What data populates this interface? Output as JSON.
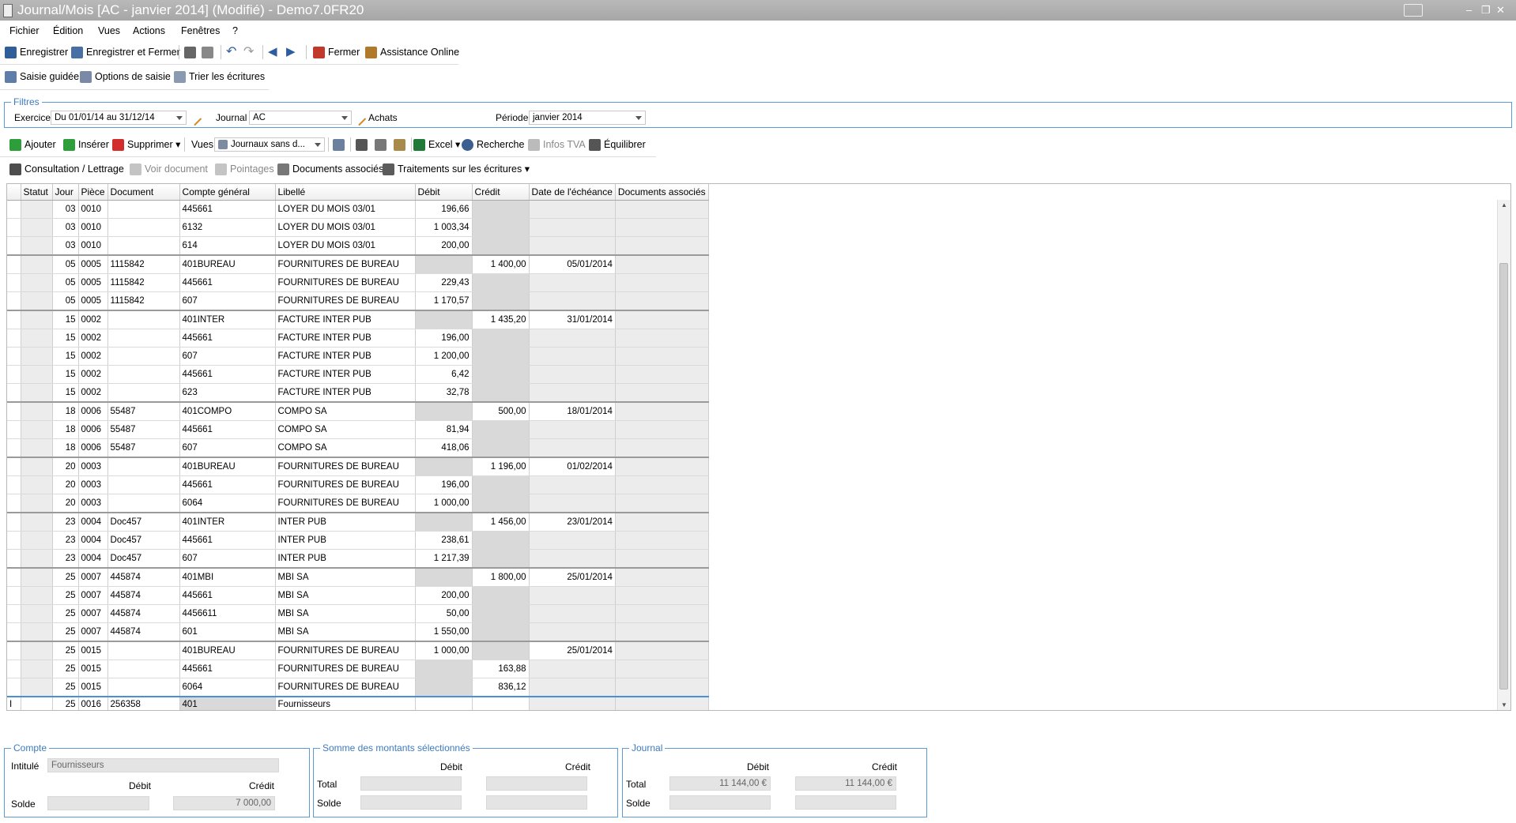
{
  "window": {
    "title": "Journal/Mois [AC - janvier 2014] (Modifié) - Demo7.0FR20",
    "min": "–",
    "max": "❐",
    "close": "✕"
  },
  "menu": [
    "Fichier",
    "Édition",
    "Vues",
    "Actions",
    "Fenêtres",
    "?"
  ],
  "toolbar1": {
    "save": "Enregistrer",
    "save_close": "Enregistrer et Fermer",
    "close": "Fermer",
    "online_help": "Assistance Online"
  },
  "toolbar2": {
    "guided_entry": "Saisie guidée",
    "entry_options": "Options de saisie",
    "sort_entries": "Trier les écritures"
  },
  "filters": {
    "title": "Filtres",
    "exercise_label": "Exercice",
    "exercise_value": "Du 01/01/14 au 31/12/14",
    "journal_label": "Journal",
    "journal_value": "AC",
    "journal_name": "Achats",
    "period_label": "Période",
    "period_value": "janvier 2014"
  },
  "toolbar3": {
    "add": "Ajouter",
    "insert": "Insérer",
    "delete": "Supprimer",
    "views_label": "Vues",
    "views_value": "Journaux sans d...",
    "excel": "Excel",
    "search": "Recherche",
    "vat_info": "Infos TVA",
    "balance": "Équilibrer"
  },
  "toolbar4": {
    "consultation": "Consultation / Lettrage",
    "view_doc": "Voir document",
    "pointings": "Pointages",
    "linked_docs": "Documents associés",
    "processing": "Traitements sur les écritures"
  },
  "grid": {
    "columns": [
      "Statut",
      "Jour",
      "Pièce",
      "Document",
      "Compte général",
      "Libellé",
      "Débit",
      "Crédit",
      "Date de l'échéance",
      "Documents associés"
    ],
    "rows": [
      {
        "jour": "03",
        "piece": "0010",
        "doc": "",
        "compte": "445661",
        "libelle": "LOYER DU MOIS 03/01",
        "debit": "196,66",
        "credit": "",
        "echeance": "",
        "g": true
      },
      {
        "jour": "03",
        "piece": "0010",
        "doc": "",
        "compte": "6132",
        "libelle": "LOYER DU MOIS 03/01",
        "debit": "1 003,34",
        "credit": "",
        "echeance": "",
        "g": false
      },
      {
        "jour": "03",
        "piece": "0010",
        "doc": "",
        "compte": "614",
        "libelle": "LOYER DU MOIS 03/01",
        "debit": "200,00",
        "credit": "",
        "echeance": "",
        "g": false
      },
      {
        "jour": "05",
        "piece": "0005",
        "doc": "1115842",
        "compte": "401BUREAU",
        "libelle": "FOURNITURES DE BUREAU",
        "debit": "",
        "credit": "1 400,00",
        "echeance": "05/01/2014",
        "g": true
      },
      {
        "jour": "05",
        "piece": "0005",
        "doc": "1115842",
        "compte": "445661",
        "libelle": "FOURNITURES DE BUREAU",
        "debit": "229,43",
        "credit": "",
        "echeance": "",
        "g": false
      },
      {
        "jour": "05",
        "piece": "0005",
        "doc": "1115842",
        "compte": "607",
        "libelle": "FOURNITURES DE BUREAU",
        "debit": "1 170,57",
        "credit": "",
        "echeance": "",
        "g": false
      },
      {
        "jour": "15",
        "piece": "0002",
        "doc": "",
        "compte": "401INTER",
        "libelle": "FACTURE INTER PUB",
        "debit": "",
        "credit": "1 435,20",
        "echeance": "31/01/2014",
        "g": true
      },
      {
        "jour": "15",
        "piece": "0002",
        "doc": "",
        "compte": "445661",
        "libelle": "FACTURE INTER PUB",
        "debit": "196,00",
        "credit": "",
        "echeance": "",
        "g": false
      },
      {
        "jour": "15",
        "piece": "0002",
        "doc": "",
        "compte": "607",
        "libelle": "FACTURE INTER PUB",
        "debit": "1 200,00",
        "credit": "",
        "echeance": "",
        "g": false
      },
      {
        "jour": "15",
        "piece": "0002",
        "doc": "",
        "compte": "445661",
        "libelle": "FACTURE INTER PUB",
        "debit": "6,42",
        "credit": "",
        "echeance": "",
        "g": false
      },
      {
        "jour": "15",
        "piece": "0002",
        "doc": "",
        "compte": "623",
        "libelle": "FACTURE INTER PUB",
        "debit": "32,78",
        "credit": "",
        "echeance": "",
        "g": false
      },
      {
        "jour": "18",
        "piece": "0006",
        "doc": "55487",
        "compte": "401COMPO",
        "libelle": "COMPO SA",
        "debit": "",
        "credit": "500,00",
        "echeance": "18/01/2014",
        "g": true
      },
      {
        "jour": "18",
        "piece": "0006",
        "doc": "55487",
        "compte": "445661",
        "libelle": "COMPO SA",
        "debit": "81,94",
        "credit": "",
        "echeance": "",
        "g": false
      },
      {
        "jour": "18",
        "piece": "0006",
        "doc": "55487",
        "compte": "607",
        "libelle": "COMPO SA",
        "debit": "418,06",
        "credit": "",
        "echeance": "",
        "g": false
      },
      {
        "jour": "20",
        "piece": "0003",
        "doc": "",
        "compte": "401BUREAU",
        "libelle": "FOURNITURES DE BUREAU",
        "debit": "",
        "credit": "1 196,00",
        "echeance": "01/02/2014",
        "g": true
      },
      {
        "jour": "20",
        "piece": "0003",
        "doc": "",
        "compte": "445661",
        "libelle": "FOURNITURES DE BUREAU",
        "debit": "196,00",
        "credit": "",
        "echeance": "",
        "g": false
      },
      {
        "jour": "20",
        "piece": "0003",
        "doc": "",
        "compte": "6064",
        "libelle": "FOURNITURES DE BUREAU",
        "debit": "1 000,00",
        "credit": "",
        "echeance": "",
        "g": false
      },
      {
        "jour": "23",
        "piece": "0004",
        "doc": "Doc457",
        "compte": "401INTER",
        "libelle": "INTER PUB",
        "debit": "",
        "credit": "1 456,00",
        "echeance": "23/01/2014",
        "g": true
      },
      {
        "jour": "23",
        "piece": "0004",
        "doc": "Doc457",
        "compte": "445661",
        "libelle": "INTER PUB",
        "debit": "238,61",
        "credit": "",
        "echeance": "",
        "g": false
      },
      {
        "jour": "23",
        "piece": "0004",
        "doc": "Doc457",
        "compte": "607",
        "libelle": "INTER PUB",
        "debit": "1 217,39",
        "credit": "",
        "echeance": "",
        "g": false
      },
      {
        "jour": "25",
        "piece": "0007",
        "doc": "445874",
        "compte": "401MBI",
        "libelle": "MBI SA",
        "debit": "",
        "credit": "1 800,00",
        "echeance": "25/01/2014",
        "g": true
      },
      {
        "jour": "25",
        "piece": "0007",
        "doc": "445874",
        "compte": "445661",
        "libelle": "MBI SA",
        "debit": "200,00",
        "credit": "",
        "echeance": "",
        "g": false
      },
      {
        "jour": "25",
        "piece": "0007",
        "doc": "445874",
        "compte": "4456611",
        "libelle": "MBI SA",
        "debit": "50,00",
        "credit": "",
        "echeance": "",
        "g": false
      },
      {
        "jour": "25",
        "piece": "0007",
        "doc": "445874",
        "compte": "601",
        "libelle": "MBI SA",
        "debit": "1 550,00",
        "credit": "",
        "echeance": "",
        "g": false
      },
      {
        "jour": "25",
        "piece": "0015",
        "doc": "",
        "compte": "401BUREAU",
        "libelle": "FOURNITURES DE BUREAU",
        "debit": "1 000,00",
        "credit": "",
        "echeance": "25/01/2014",
        "g": true
      },
      {
        "jour": "25",
        "piece": "0015",
        "doc": "",
        "compte": "445661",
        "libelle": "FOURNITURES DE BUREAU",
        "debit": "",
        "credit": "163,88",
        "echeance": "",
        "g": false
      },
      {
        "jour": "25",
        "piece": "0015",
        "doc": "",
        "compte": "6064",
        "libelle": "FOURNITURES DE BUREAU",
        "debit": "",
        "credit": "836,12",
        "echeance": "",
        "g": false
      }
    ],
    "edit_row": {
      "jour": "25",
      "piece": "0016",
      "doc": "256358",
      "compte": "401",
      "libelle": "Fournisseurs"
    }
  },
  "account_panel": {
    "title": "Compte",
    "label_name": "Intitulé",
    "name_value": "Fournisseurs",
    "debit_label": "Débit",
    "credit_label": "Crédit",
    "balance_label": "Solde",
    "balance_credit": "7 000,00"
  },
  "sum_panel": {
    "title": "Somme des montants sélectionnés",
    "debit_label": "Débit",
    "credit_label": "Crédit",
    "total_label": "Total",
    "balance_label": "Solde"
  },
  "journal_panel": {
    "title": "Journal",
    "debit_label": "Débit",
    "credit_label": "Crédit",
    "total_label": "Total",
    "balance_label": "Solde",
    "total_debit": "11 144,00 €",
    "total_credit": "11 144,00 €"
  },
  "colors": {
    "group_border": "#5b9bd5",
    "titlebar": "#aaaaaa",
    "cell_shade": "#d9d9d9",
    "edit_border": "#4a90d9"
  }
}
